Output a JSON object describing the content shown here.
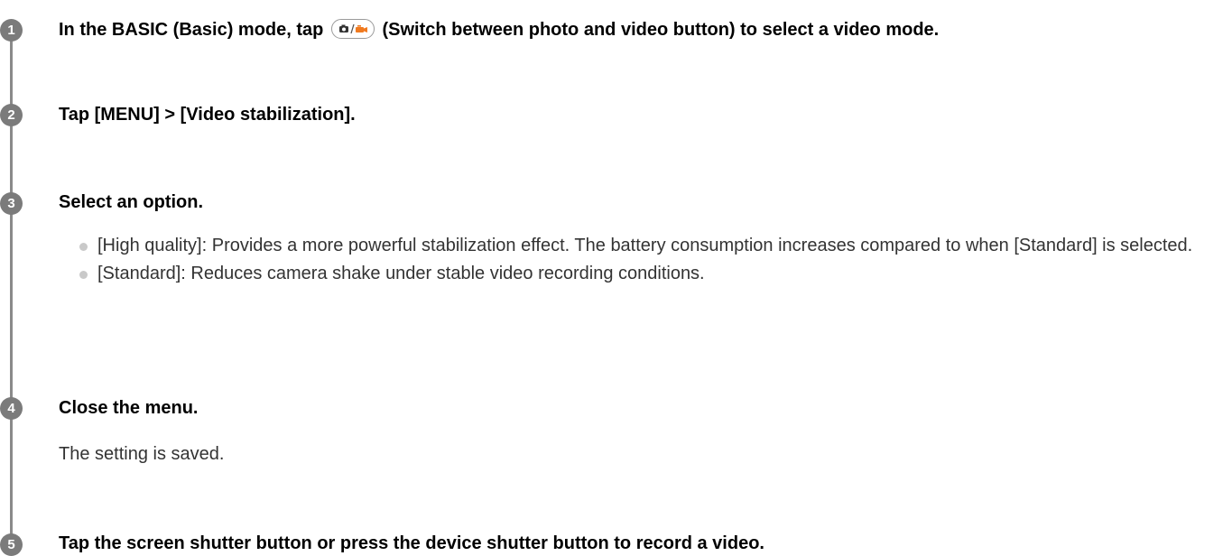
{
  "steps": [
    {
      "number": "1",
      "title_before_icon": "In the BASIC (Basic) mode, tap",
      "icon": "photo-video-switch-icon",
      "title_after_icon": "(Switch between photo and video button) to select a video mode."
    },
    {
      "number": "2",
      "title": "Tap [MENU] > [Video stabilization]."
    },
    {
      "number": "3",
      "title": "Select an option.",
      "options": [
        "[High quality]: Provides a more powerful stabilization effect. The battery consumption increases compared to when [Standard] is selected.",
        "[Standard]: Reduces camera shake under stable video recording conditions."
      ]
    },
    {
      "number": "4",
      "title": "Close the menu.",
      "note": "The setting is saved."
    },
    {
      "number": "5",
      "title": "Tap the screen shutter button or press the device shutter button to record a video."
    }
  ],
  "colors": {
    "badge": "#7b7b7b",
    "timeline": "#8a8a8a",
    "bullet": "#c9c9c9",
    "video_icon_accent": "#f07a20"
  }
}
